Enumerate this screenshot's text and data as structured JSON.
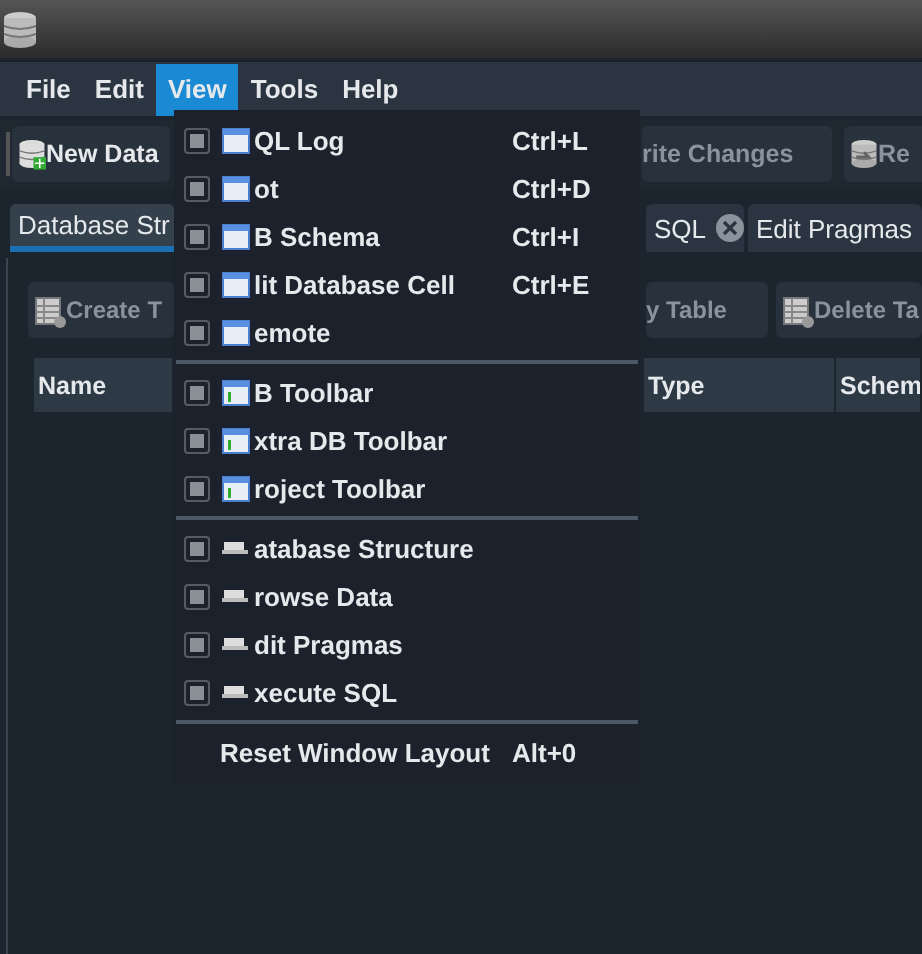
{
  "menubar": [
    {
      "label": "File",
      "selected": false
    },
    {
      "label": "Edit",
      "selected": false
    },
    {
      "label": "View",
      "selected": true
    },
    {
      "label": "Tools",
      "selected": false
    },
    {
      "label": "Help",
      "selected": false
    }
  ],
  "toolbar": [
    {
      "label": "New Data",
      "kind": "new"
    },
    {
      "label": "rite Changes",
      "kind": "plain"
    },
    {
      "label": "Re",
      "kind": "revert"
    }
  ],
  "tabs": [
    {
      "label": "Database Str",
      "selected": true,
      "closable": false
    },
    {
      "label": "SQL",
      "selected": false,
      "closable": true
    },
    {
      "label": "Edit Pragmas",
      "selected": false,
      "closable": false
    }
  ],
  "table_toolbar": [
    {
      "label": "Create T",
      "kind": "table"
    },
    {
      "label": "y Table",
      "kind": "plain"
    },
    {
      "label": "Delete Ta",
      "kind": "table"
    }
  ],
  "table": {
    "columns": [
      "Name",
      "Type",
      "Schem"
    ]
  },
  "view_menu": {
    "sections": [
      [
        {
          "label": "QL Log",
          "shortcut": "Ctrl+L",
          "checked": false,
          "kind": "window"
        },
        {
          "label": "ot",
          "shortcut": "Ctrl+D",
          "checked": false,
          "kind": "window"
        },
        {
          "label": "B Schema",
          "shortcut": "Ctrl+I",
          "checked": false,
          "kind": "window"
        },
        {
          "label": "lit Database Cell",
          "shortcut": "Ctrl+E",
          "checked": false,
          "kind": "window"
        },
        {
          "label": "emote",
          "checked": false,
          "kind": "window"
        }
      ],
      [
        {
          "label": "B Toolbar",
          "checked": false,
          "kind": "toolbar"
        },
        {
          "label": "xtra DB Toolbar",
          "checked": false,
          "kind": "toolbar"
        },
        {
          "label": "roject Toolbar",
          "checked": false,
          "kind": "toolbar"
        }
      ],
      [
        {
          "label": "atabase Structure",
          "checked": false,
          "kind": "tab"
        },
        {
          "label": "rowse Data",
          "checked": false,
          "kind": "tab"
        },
        {
          "label": "dit Pragmas",
          "checked": false,
          "kind": "tab"
        },
        {
          "label": "xecute SQL",
          "checked": false,
          "kind": "tab"
        }
      ],
      [
        {
          "label": "Reset Window Layout",
          "shortcut": "Alt+0",
          "kind": "action"
        }
      ]
    ]
  }
}
